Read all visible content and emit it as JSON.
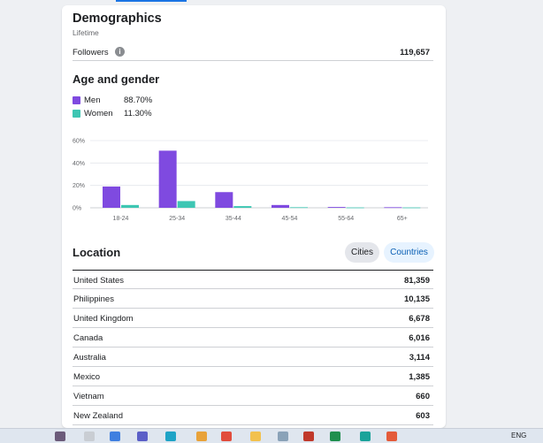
{
  "demographics": {
    "title": "Demographics",
    "subtitle": "Lifetime",
    "followers_label": "Followers",
    "followers_value": "119,657"
  },
  "age_gender": {
    "title": "Age and gender",
    "legend": [
      {
        "name": "Men",
        "pct": "88.70%",
        "color": "#7f4ae0"
      },
      {
        "name": "Women",
        "pct": "11.30%",
        "color": "#3ec6b3"
      }
    ]
  },
  "chart_data": {
    "type": "bar",
    "categories": [
      "18-24",
      "25-34",
      "35-44",
      "45-54",
      "55-64",
      "65+"
    ],
    "series": [
      {
        "name": "Men",
        "color": "#7f4ae0",
        "values": [
          19,
          51,
          14,
          2.5,
          0.7,
          0.5
        ]
      },
      {
        "name": "Women",
        "color": "#3ec6b3",
        "values": [
          2.5,
          6,
          1.5,
          0.5,
          0.3,
          0.3
        ]
      }
    ],
    "yticks": [
      "0%",
      "20%",
      "40%",
      "60%"
    ],
    "ylim": [
      0,
      60
    ],
    "grid": true
  },
  "location": {
    "title": "Location",
    "tabs": [
      "Cities",
      "Countries"
    ],
    "rows": [
      {
        "name": "United States",
        "value": "81,359"
      },
      {
        "name": "Philippines",
        "value": "10,135"
      },
      {
        "name": "United Kingdom",
        "value": "6,678"
      },
      {
        "name": "Canada",
        "value": "6,016"
      },
      {
        "name": "Australia",
        "value": "3,114"
      },
      {
        "name": "Mexico",
        "value": "1,385"
      },
      {
        "name": "Vietnam",
        "value": "660"
      },
      {
        "name": "New Zealand",
        "value": "603"
      }
    ]
  },
  "taskbar": {
    "lang": "ENG",
    "icons": [
      "cat-icon",
      "file-icon",
      "copilot-icon",
      "teams-icon",
      "edge-icon",
      "search-icon",
      "chrome-icon",
      "folder-icon",
      "calculator-icon",
      "notepad-icon",
      "excel-icon",
      "app-icon",
      "chrome-profile-icon"
    ]
  }
}
